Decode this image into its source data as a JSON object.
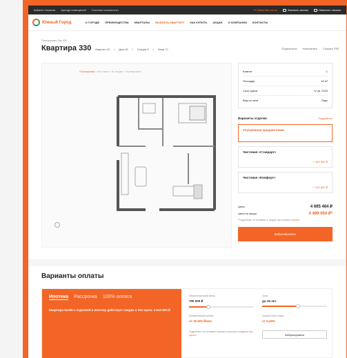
{
  "topbar": {
    "links": [
      "Кабинет Казахов",
      "Аренда помещений",
      "Система лояльности"
    ],
    "phone": "+7 (3xx) 3xx-xx-xx",
    "callback": "Заказать звонок",
    "write": "Написать письмо"
  },
  "nav": {
    "logo_text": "Южный Город",
    "items": [
      "О ГОРОДЕ",
      "ПРЕИМУЩЕСТВА",
      "КВАРТАЛЫ",
      "ВЫБРАТЬ КВАРТИРУ",
      "КАК КУПИТЬ",
      "АКЦИИ",
      "О КОМПАНИИ",
      "КОНТАКТЫ"
    ]
  },
  "breadcrumb": "Планировка 3кк 429",
  "title": "Квартира 330",
  "meta": [
    "Квартал 42",
    "Дом 16",
    "Секция 9",
    "Этаж 17"
  ],
  "actions": [
    "Поделиться",
    "Напечатать",
    "Скачать PDF"
  ],
  "plan": {
    "crumbs": [
      "Планировка",
      "На этаже",
      "В секции",
      "На квартале"
    ]
  },
  "info": [
    {
      "label": "Комнат",
      "value": "1"
    },
    {
      "label": "Площадь",
      "value": "42 м²"
    },
    {
      "label": "Срок сдачи",
      "value": "IV кв. 2020"
    },
    {
      "label": "Вид из окна",
      "value": "Парк"
    }
  ],
  "finish": {
    "heading": "Варианты отделки",
    "link": "Подробнее",
    "options": [
      {
        "name": "Улучшенная предчистовая",
        "price": ""
      },
      {
        "name": "Чистовая «Стандарт»",
        "price": "+ 184 450 ₽"
      },
      {
        "name": "Чистовая «Комфорт»",
        "price": "+ 244 800 ₽"
      }
    ]
  },
  "prices": {
    "price_label": "Цена",
    "price_value": "4 695 464 ₽",
    "discount_label": "Цена по акции",
    "discount_value": "4 499 064 ₽*",
    "note": "*Подробные об условиях и скидке при покупке",
    "note_link": "ссылка"
  },
  "book_button": "Забронировать",
  "payment": {
    "title": "Варианты оплаты",
    "tabs": [
      "Ипотека",
      "Рассрочка",
      "100% оплата"
    ],
    "description": "Квартира №330 с отделкой в ипотеку действует скидка о 3%! Цена: 4 544 900 ₽",
    "fields": [
      {
        "label": "Первоначальный взнос",
        "value": "700 000 ₽",
        "fill": 0.3
      },
      {
        "label": "Срок",
        "value": "до 15 лет",
        "fill": 0.55
      },
      {
        "label": "Ежемесячный платёж",
        "value": "от 35 600 ₽/мес",
        "fill": null
      },
      {
        "label": "Процентная ставка",
        "value": "от 6,49%",
        "fill": null
      }
    ],
    "note": "Подробнее об условиях покупки в ипотеку в разделе",
    "note_link": "Как купить",
    "calc_button": "Забронировать"
  }
}
